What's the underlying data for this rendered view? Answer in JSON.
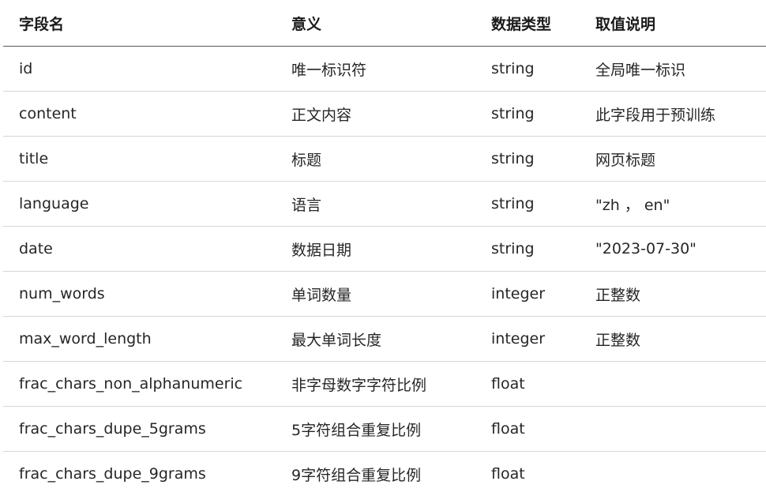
{
  "table": {
    "headers": [
      "字段名",
      "意义",
      "数据类型",
      "取值说明"
    ],
    "rows": [
      [
        "id",
        "唯一标识符",
        "string",
        "全局唯一标识"
      ],
      [
        "content",
        "正文内容",
        "string",
        "此字段用于预训练"
      ],
      [
        "title",
        "标题",
        "string",
        "网页标题"
      ],
      [
        "language",
        "语言",
        "string",
        "\"zh ， en\""
      ],
      [
        "date",
        "数据日期",
        "string",
        "\"2023-07-30\""
      ],
      [
        "num_words",
        "单词数量",
        "integer",
        "正整数"
      ],
      [
        "max_word_length",
        "最大单词长度",
        "integer",
        "正整数"
      ],
      [
        "frac_chars_non_alphanumeric",
        "非字母数字字符比例",
        "float",
        ""
      ],
      [
        "frac_chars_dupe_5grams",
        "5字符组合重复比例",
        "float",
        ""
      ],
      [
        "frac_chars_dupe_9grams",
        "9字符组合重复比例",
        "float",
        ""
      ]
    ]
  }
}
